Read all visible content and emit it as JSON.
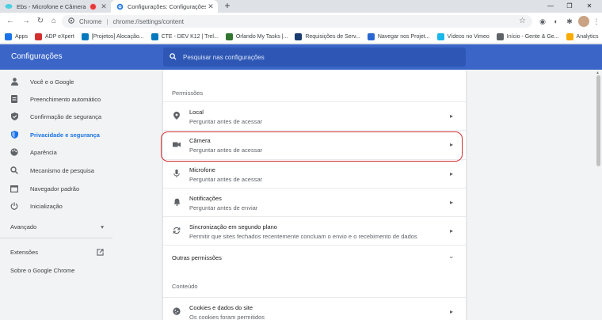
{
  "tabs": [
    {
      "title": "Ebs - Microfone e Câmera",
      "recording": true
    },
    {
      "title": "Configurações: Configurações d..."
    }
  ],
  "window_controls": {
    "minimize": "—",
    "restore": "❐",
    "close": "✕"
  },
  "address_bar": {
    "origin": "Chrome",
    "separator": "|",
    "url": "chrome://settings/content"
  },
  "bookmarks": [
    {
      "label": "Apps",
      "icon": "apps-grid-icon",
      "color": "#1a73e8"
    },
    {
      "label": "ADP eXpert",
      "icon": "adp-icon",
      "color": "#d32f2f"
    },
    {
      "label": "[Projetos] Alocação...",
      "icon": "trello-icon",
      "color": "#0079bf"
    },
    {
      "label": "CTE - DEV K12 | Trel...",
      "icon": "trello-icon",
      "color": "#0079bf"
    },
    {
      "label": "Orlando My Tasks |...",
      "icon": "ms-planner-icon",
      "color": "#31752f"
    },
    {
      "label": "Requisições de Serv...",
      "icon": "bookmark-icon",
      "color": "#1a3b6e"
    },
    {
      "label": "Navegar nos Projet...",
      "icon": "diamond-icon",
      "color": "#2b67d1"
    },
    {
      "label": "Vídeos no Vimeo",
      "icon": "vimeo-icon",
      "color": "#1ab7ea"
    },
    {
      "label": "Início - Gente & Ge...",
      "icon": "globe-icon",
      "color": "#5f6368"
    },
    {
      "label": "Analytics",
      "icon": "analytics-icon",
      "color": "#f9ab00"
    }
  ],
  "header": {
    "title": "Configurações",
    "search_placeholder": "Pesquisar nas configurações"
  },
  "sidebar": {
    "items": [
      {
        "label": "Você e o Google",
        "icon": "person-icon"
      },
      {
        "label": "Preenchimento automático",
        "icon": "autofill-icon"
      },
      {
        "label": "Confirmação de segurança",
        "icon": "shield-check-icon"
      },
      {
        "label": "Privacidade e segurança",
        "icon": "privacy-shield-icon",
        "active": true
      },
      {
        "label": "Aparência",
        "icon": "palette-icon"
      },
      {
        "label": "Mecanismo de pesquisa",
        "icon": "search-icon"
      },
      {
        "label": "Navegador padrão",
        "icon": "browser-icon"
      },
      {
        "label": "Inicialização",
        "icon": "power-icon"
      }
    ],
    "advanced": "Avançado",
    "extensions": "Extensões",
    "about": "Sobre o Google Chrome"
  },
  "content": {
    "permissions_label": "Permissões",
    "permissions": [
      {
        "title": "Local",
        "subtitle": "Perguntar antes de acessar",
        "icon": "location-icon"
      },
      {
        "title": "Câmera",
        "subtitle": "Perguntar antes de acessar",
        "icon": "camera-icon",
        "highlighted": true
      },
      {
        "title": "Microfone",
        "subtitle": "Perguntar antes de acessar",
        "icon": "microphone-icon"
      },
      {
        "title": "Notificações",
        "subtitle": "Perguntar antes de enviar",
        "icon": "bell-icon"
      },
      {
        "title": "Sincronização em segundo plano",
        "subtitle": "Permitir que sites fechados recentemente concluam o envio e o recebimento de dados",
        "icon": "sync-icon"
      }
    ],
    "other_permissions": "Outras permissões",
    "content_label": "Conteúdo",
    "cookies": {
      "title": "Cookies e dados do site",
      "subtitle": "Os cookies foram permitidos",
      "icon": "cookie-icon"
    }
  },
  "colors": {
    "header_blue": "#3b66c8",
    "active_blue": "#1a73e8",
    "highlight_red": "#d32f2f"
  }
}
